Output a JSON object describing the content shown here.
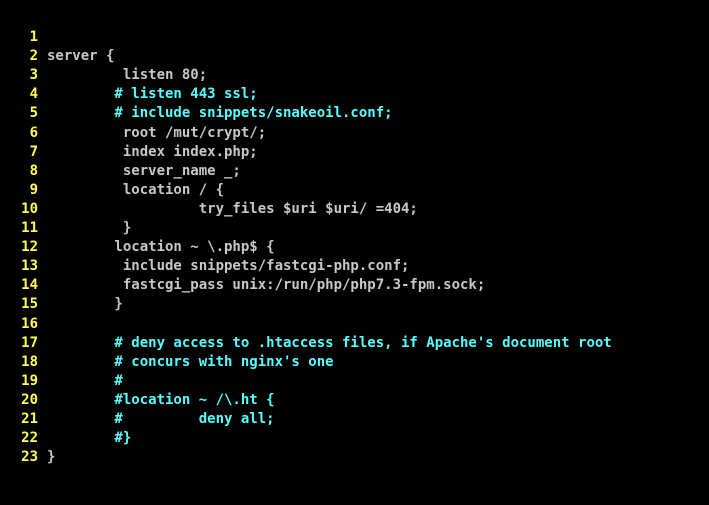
{
  "colors": {
    "background": "#000000",
    "line_number": "#ffff55",
    "code": "#c8c8c8",
    "comment": "#55ffff"
  },
  "editor": {
    "lines": [
      {
        "number": "1",
        "text": "server {",
        "comment": false
      },
      {
        "number": "2",
        "text": "         listen 80;",
        "comment": false
      },
      {
        "number": "3",
        "text": "        # listen 443 ssl;",
        "comment": true
      },
      {
        "number": "4",
        "text": "        # include snippets/snakeoil.conf;",
        "comment": true
      },
      {
        "number": "5",
        "text": "         root /mut/crypt/;",
        "comment": false
      },
      {
        "number": "6",
        "text": "         index index.php;",
        "comment": false
      },
      {
        "number": "7",
        "text": "         server_name _;",
        "comment": false
      },
      {
        "number": "8",
        "text": "         location / {",
        "comment": false
      },
      {
        "number": "9",
        "text": "                  try_files $uri $uri/ =404;",
        "comment": false
      },
      {
        "number": "10",
        "text": "         }",
        "comment": false
      },
      {
        "number": "11",
        "text": "        location ~ \\.php$ {",
        "comment": false
      },
      {
        "number": "12",
        "text": "         include snippets/fastcgi-php.conf;",
        "comment": false
      },
      {
        "number": "13",
        "text": "         fastcgi_pass unix:/run/php/php7.3-fpm.sock;",
        "comment": false
      },
      {
        "number": "14",
        "text": "        }",
        "comment": false
      },
      {
        "number": "15",
        "text": "",
        "comment": false
      },
      {
        "number": "16",
        "text": "        # deny access to .htaccess files, if Apache's document root",
        "comment": true
      },
      {
        "number": "17",
        "text": "        # concurs with nginx's one",
        "comment": true
      },
      {
        "number": "18",
        "text": "        #",
        "comment": true
      },
      {
        "number": "19",
        "text": "        #location ~ /\\.ht {",
        "comment": true
      },
      {
        "number": "20",
        "text": "        #         deny all;",
        "comment": true
      },
      {
        "number": "21",
        "text": "        #}",
        "comment": true
      },
      {
        "number": "22",
        "text": "}",
        "comment": false
      },
      {
        "number": "23",
        "text": "",
        "comment": false
      }
    ]
  }
}
